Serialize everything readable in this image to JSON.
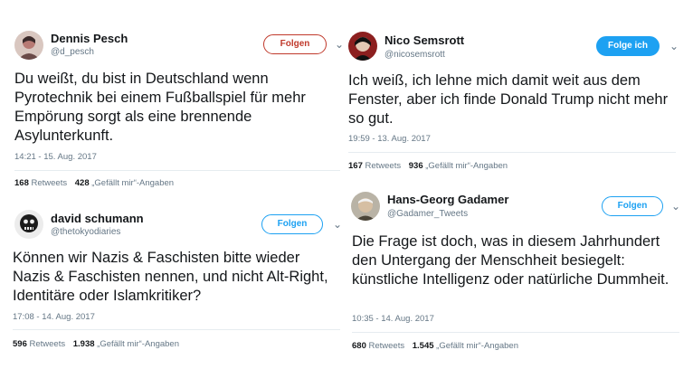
{
  "tweets": [
    {
      "name": "Dennis Pesch",
      "handle": "@d_pesch",
      "follow": "Folgen",
      "text": "Du weißt, du bist in Deutschland wenn Pyrotechnik bei einem Fußballspiel für mehr Empörung sorgt als eine brennende Asylunterkunft.",
      "time": "14:21 - 15. Aug. 2017",
      "retweets": "168",
      "retweets_label": "Retweets",
      "likes": "428",
      "likes_label": "„Gefällt mir“-Angaben"
    },
    {
      "name": "david schumann",
      "handle": "@thetokyodiaries",
      "follow": "Folgen",
      "text": "Können wir Nazis & Faschisten bitte wieder Nazis & Faschisten nennen, und nicht Alt-Right, Identitäre oder Islamkritiker?",
      "time": "17:08 - 14. Aug. 2017",
      "retweets": "596",
      "retweets_label": "Retweets",
      "likes": "1.938",
      "likes_label": "„Gefällt mir“-Angaben"
    },
    {
      "name": "Nico Semsrott",
      "handle": "@nicosemsrott",
      "follow": "Folge ich",
      "text": "Ich weiß, ich lehne mich damit weit aus dem Fenster, aber ich finde Donald Trump nicht mehr so gut.",
      "time": "19:59 - 13. Aug. 2017",
      "retweets": "167",
      "retweets_label": "Retweets",
      "likes": "936",
      "likes_label": "„Gefällt mir“-Angaben"
    },
    {
      "name": "Hans-Georg Gadamer",
      "handle": "@Gadamer_Tweets",
      "follow": "Folgen",
      "text": "Die Frage ist doch, was in diesem Jahrhundert den Untergang der Menschheit besiegelt: künstliche Intelligenz oder natürliche Dummheit.",
      "time": "10:35 - 14. Aug. 2017",
      "retweets": "680",
      "retweets_label": "Retweets",
      "likes": "1.545",
      "likes_label": "„Gefällt mir“-Angaben"
    }
  ],
  "icons": {
    "avatar": "avatar-icon",
    "menu": "chevron-down-icon"
  },
  "colors": {
    "follow_red": "#c0392b",
    "follow_blue": "#1da1f2",
    "text": "#14171a",
    "muted": "#657786"
  }
}
